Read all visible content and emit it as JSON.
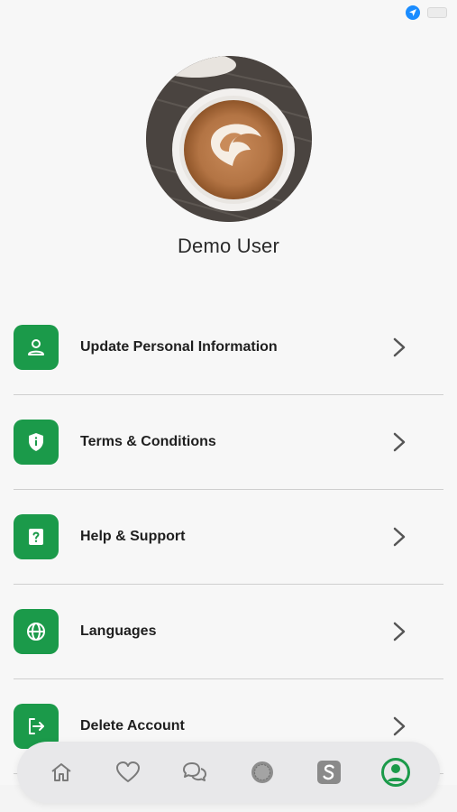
{
  "status_bar": {
    "location_icon": "location-arrow-icon",
    "battery_icon": "battery-icon",
    "location_color": "#1a8cff"
  },
  "profile": {
    "name": "Demo User",
    "avatar": "latte-art-coffee-photo"
  },
  "menu": {
    "accent_color": "#1b9a4a",
    "items": [
      {
        "label": "Update Personal Information",
        "icon": "person-icon"
      },
      {
        "label": "Terms & Conditions",
        "icon": "shield-icon"
      },
      {
        "label": "Help & Support",
        "icon": "question-icon"
      },
      {
        "label": "Languages",
        "icon": "globe-icon"
      },
      {
        "label": "Delete Account",
        "icon": "logout-icon"
      }
    ]
  },
  "bottom_nav": {
    "items": [
      {
        "icon": "home-icon",
        "active": false
      },
      {
        "icon": "heart-icon",
        "active": false
      },
      {
        "icon": "chat-icon",
        "active": false
      },
      {
        "icon": "badge-icon",
        "active": false
      },
      {
        "icon": "s-logo-icon",
        "active": false
      },
      {
        "icon": "profile-icon",
        "active": true
      }
    ],
    "active_color": "#1b9a4a"
  }
}
